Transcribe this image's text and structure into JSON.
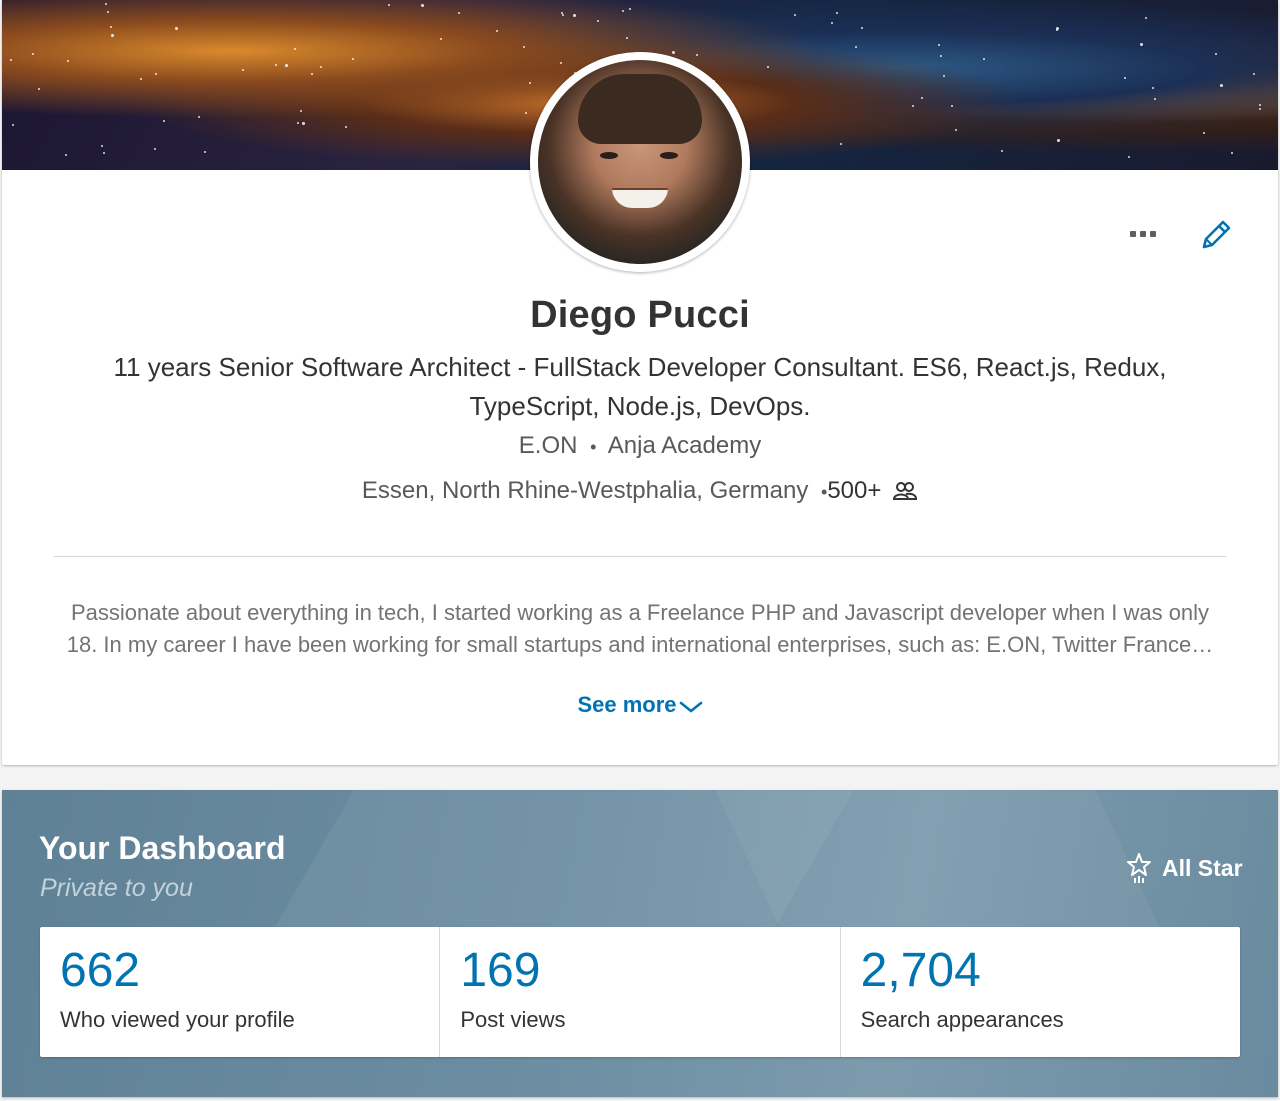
{
  "profile": {
    "name": "Diego Pucci",
    "headline": "11 years Senior Software Architect - FullStack Developer Consultant. ES6, React.js, Redux, TypeScript, Node.js, DevOps.",
    "company": "E.ON",
    "separator": "•",
    "education": "Anja Academy",
    "location": "Essen, North Rhine-Westphalia, Germany",
    "location_separator": "•",
    "connections": "500+",
    "summary": "Passionate about everything in tech, I started working as a Freelance PHP and Javascript developer when I was only 18. In my career I have been working for small startups and international enterprises, such as: E.ON, Twitter France…",
    "see_more_label": "See more",
    "more_icon": "ellipsis-icon",
    "edit_icon": "pencil-icon",
    "accent_color": "#0073b1"
  },
  "dashboard": {
    "title": "Your Dashboard",
    "subtitle": "Private to you",
    "badge_label": "All Star",
    "badge_icon": "star-icon",
    "stats": [
      {
        "value": "662",
        "label": "Who viewed your profile"
      },
      {
        "value": "169",
        "label": "Post views"
      },
      {
        "value": "2,704",
        "label": "Search appearances"
      }
    ]
  }
}
